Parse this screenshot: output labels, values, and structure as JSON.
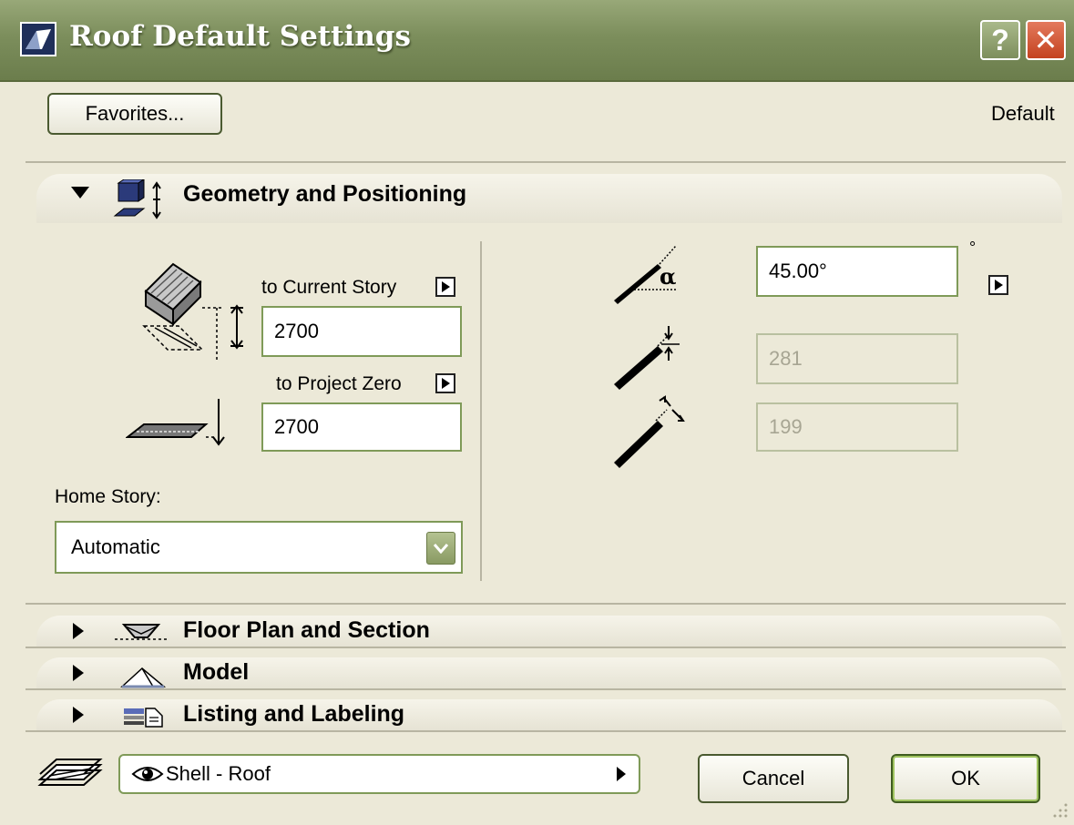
{
  "window": {
    "title": "Roof Default Settings",
    "help_label": "?",
    "close_label": "✕"
  },
  "top": {
    "favorites_label": "Favorites...",
    "default_label": "Default"
  },
  "geometry": {
    "title": "Geometry and Positioning",
    "to_current_story_label": "to Current Story",
    "current_story_value": "2700",
    "to_project_zero_label": "to Project Zero",
    "project_zero_value": "2700",
    "home_story_label": "Home Story:",
    "home_story_value": "Automatic",
    "angle_value": "45.00°",
    "angle_unit": "°",
    "thickness_value": "281",
    "perpendicular_value": "199"
  },
  "sections": [
    {
      "title": "Floor Plan and Section",
      "icon": "floor-plan-icon"
    },
    {
      "title": "Model",
      "icon": "model-icon"
    },
    {
      "title": "Listing and Labeling",
      "icon": "listing-icon"
    }
  ],
  "bottom": {
    "layer_value": "Shell - Roof",
    "cancel_label": "Cancel",
    "ok_label": "OK"
  },
  "colors": {
    "titlebar": "#7c8e5c",
    "dialog_bg": "#ece9d8",
    "field_border": "#7f9a58"
  }
}
